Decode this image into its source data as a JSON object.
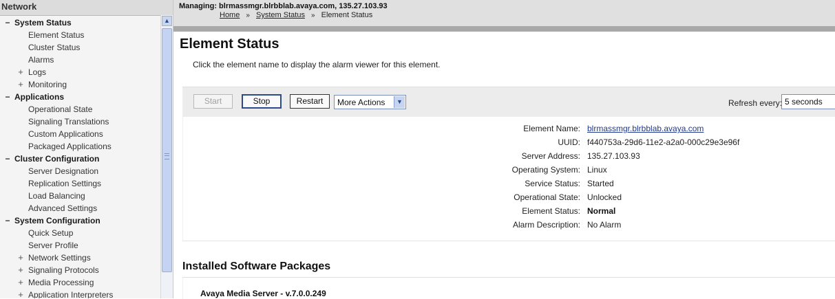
{
  "nav": {
    "title": "Network",
    "items": [
      {
        "kind": "group",
        "toggle": "−",
        "label": "System Status"
      },
      {
        "kind": "item",
        "toggle": "",
        "label": "Element Status"
      },
      {
        "kind": "item",
        "toggle": "",
        "label": "Cluster Status"
      },
      {
        "kind": "item",
        "toggle": "",
        "label": "Alarms"
      },
      {
        "kind": "item",
        "toggle": "+",
        "label": "Logs"
      },
      {
        "kind": "item",
        "toggle": "+",
        "label": "Monitoring"
      },
      {
        "kind": "group",
        "toggle": "−",
        "label": "Applications"
      },
      {
        "kind": "item",
        "toggle": "",
        "label": "Operational State"
      },
      {
        "kind": "item",
        "toggle": "",
        "label": "Signaling Translations"
      },
      {
        "kind": "item",
        "toggle": "",
        "label": "Custom Applications"
      },
      {
        "kind": "item",
        "toggle": "",
        "label": "Packaged Applications"
      },
      {
        "kind": "group",
        "toggle": "−",
        "label": "Cluster Configuration"
      },
      {
        "kind": "item",
        "toggle": "",
        "label": "Server Designation"
      },
      {
        "kind": "item",
        "toggle": "",
        "label": "Replication Settings"
      },
      {
        "kind": "item",
        "toggle": "",
        "label": "Load Balancing"
      },
      {
        "kind": "item",
        "toggle": "",
        "label": "Advanced Settings"
      },
      {
        "kind": "group",
        "toggle": "−",
        "label": "System Configuration"
      },
      {
        "kind": "item",
        "toggle": "",
        "label": "Quick Setup"
      },
      {
        "kind": "item",
        "toggle": "",
        "label": "Server Profile"
      },
      {
        "kind": "item",
        "toggle": "+",
        "label": "Network Settings"
      },
      {
        "kind": "item",
        "toggle": "+",
        "label": "Signaling Protocols"
      },
      {
        "kind": "item",
        "toggle": "+",
        "label": "Media Processing"
      },
      {
        "kind": "item",
        "toggle": "+",
        "label": "Application Interpreters"
      }
    ]
  },
  "header": {
    "managing": "Managing: blrmassmgr.blrbblab.avaya.com, 135.27.103.93",
    "breadcrumb": [
      "Home",
      "System Status",
      "Element Status"
    ],
    "separator": "»"
  },
  "page": {
    "title": "Element Status",
    "description": "Click the element name to display the alarm viewer for this element."
  },
  "toolbar": {
    "start_label": "Start",
    "stop_label": "Stop",
    "restart_label": "Restart",
    "more_actions": "More Actions",
    "refresh_label": "Refresh every:",
    "refresh_value": "5 seconds"
  },
  "details": [
    {
      "label": "Element Name:",
      "value": "blrmassmgr.blrbblab.avaya.com",
      "style": "link"
    },
    {
      "label": "UUID:",
      "value": "f440753a-29d6-11e2-a2a0-000c29e3e96f",
      "style": ""
    },
    {
      "label": "Server Address:",
      "value": "135.27.103.93",
      "style": ""
    },
    {
      "label": "Operating System:",
      "value": "Linux",
      "style": ""
    },
    {
      "label": "Service Status:",
      "value": "Started",
      "style": ""
    },
    {
      "label": "Operational State:",
      "value": "Unlocked",
      "style": ""
    },
    {
      "label": "Element Status:",
      "value": "Normal",
      "style": "bold"
    },
    {
      "label": "Alarm Description:",
      "value": "No Alarm",
      "style": ""
    }
  ],
  "packages": {
    "title": "Installed Software Packages",
    "items": [
      "Avaya Media Server - v.7.0.0.249"
    ]
  },
  "icons": {
    "scroll_up": "chevron-up-icon",
    "dropdown": "chevron-down-icon",
    "expand": "plus-icon",
    "collapse": "minus-icon"
  }
}
